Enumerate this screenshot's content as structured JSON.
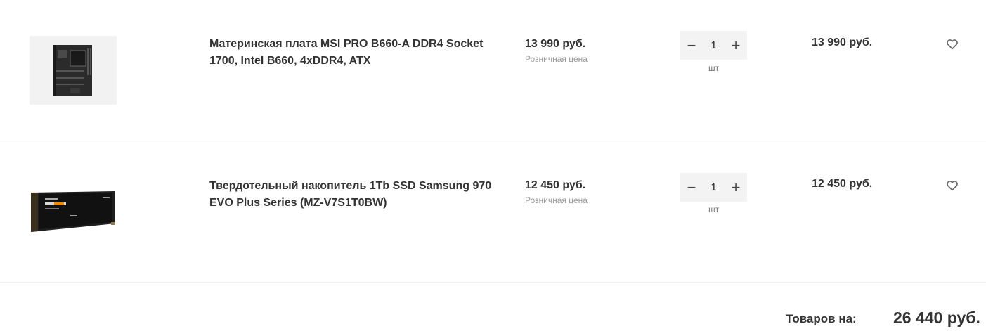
{
  "cart": {
    "items": [
      {
        "name": "Материнская плата MSI PRO B660-A DDR4 Socket 1700, Intel B660, 4xDDR4, ATX",
        "price": "13 990 руб.",
        "price_note": "Розничная цена",
        "quantity": "1",
        "unit": "шт",
        "total": "13 990 руб.",
        "decrease_symbol": "−",
        "increase_symbol": "+",
        "image_icon": "motherboard-image",
        "favorite_icon": "heart-outline-icon"
      },
      {
        "name": "Твердотельный накопитель 1Tb SSD Samsung 970 EVO Plus Series (MZ-V7S1T0BW)",
        "price": "12 450 руб.",
        "price_note": "Розничная цена",
        "quantity": "1",
        "unit": "шт",
        "total": "12 450 руб.",
        "decrease_symbol": "−",
        "increase_symbol": "+",
        "image_icon": "ssd-image",
        "favorite_icon": "heart-outline-icon"
      }
    ],
    "summary": {
      "label": "Товаров на:",
      "value": "26 440 руб."
    }
  }
}
